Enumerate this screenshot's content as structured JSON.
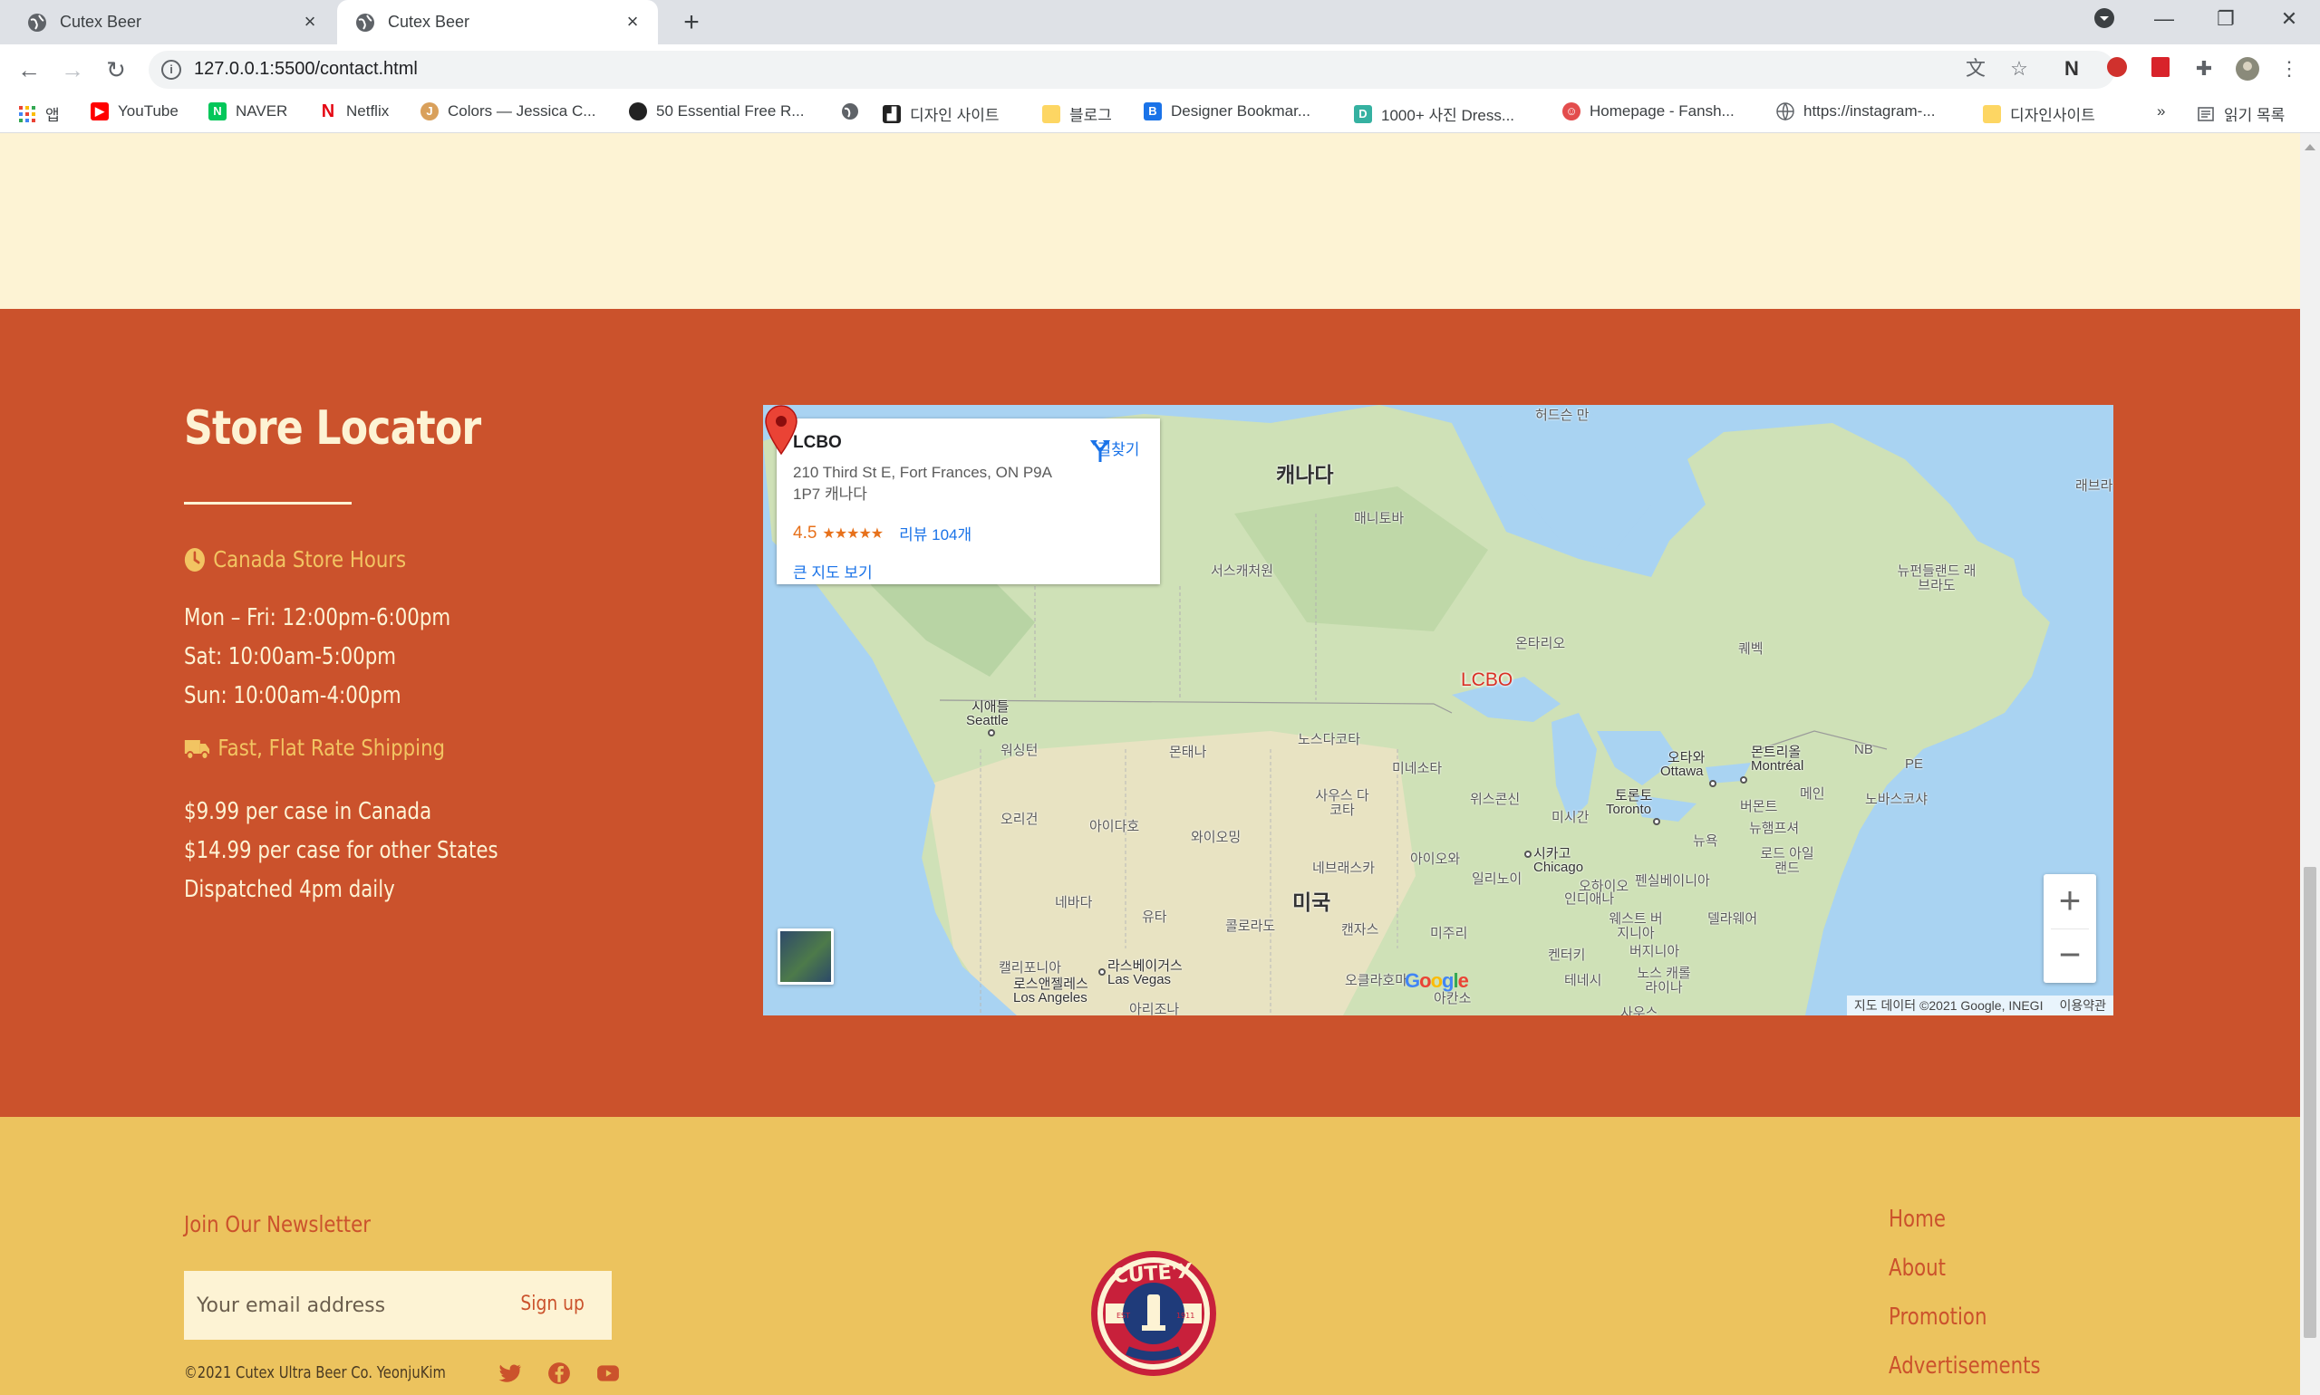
{
  "browser": {
    "tabs": [
      {
        "title": "Cutex Beer",
        "active": false
      },
      {
        "title": "Cutex Beer",
        "active": true
      }
    ],
    "url": "127.0.0.1:5500/contact.html",
    "bookmarks": [
      {
        "label": "앱",
        "icon": "apps-grid-icon"
      },
      {
        "label": "YouTube",
        "icon": "youtube-icon",
        "color": "#ff0000"
      },
      {
        "label": "NAVER",
        "icon": "naver-icon",
        "color": "#03c75a"
      },
      {
        "label": "Netflix",
        "icon": "netflix-icon",
        "color": "#e50914"
      },
      {
        "label": "Colors — Jessica C...",
        "icon": "colors-icon",
        "color": "#d9a05b"
      },
      {
        "label": "50 Essential Free R...",
        "icon": "dark-circle-icon",
        "color": "#222222"
      },
      {
        "label": "",
        "icon": "globe-icon"
      },
      {
        "label": "디자인 사이트",
        "icon": "folder-icon"
      },
      {
        "label": "블로그",
        "icon": "folder-icon"
      },
      {
        "label": "Designer Bookmar...",
        "icon": "designer-bookmark-icon",
        "color": "#1a73e8"
      },
      {
        "label": "1000+ 사진 Dress...",
        "icon": "dress-icon",
        "color": "#35b1a1"
      },
      {
        "label": "Homepage - Fansh...",
        "icon": "fansh-icon",
        "color": "#e34d4d"
      },
      {
        "label": "https://instagram-...",
        "icon": "globe-icon"
      },
      {
        "label": "디자인사이트",
        "icon": "folder-icon"
      }
    ],
    "reading_list": "읽기 목록",
    "more_bookmarks": "»"
  },
  "store_locator": {
    "title": "Store Locator",
    "hours_heading": "Canada Store Hours",
    "hours": [
      "Mon – Fri: 12:00pm-6:00pm",
      "Sat: 10:00am-5:00pm",
      "Sun: 10:00am-4:00pm"
    ],
    "shipping_heading": "Fast, Flat Rate Shipping",
    "shipping": [
      "$9.99 per case in Canada",
      "$14.99 per case for other States",
      "Dispatched 4pm daily"
    ]
  },
  "map": {
    "place_name": "LCBO",
    "address": "210 Third St E, Fort Frances, ON P9A 1P7 캐나다",
    "rating": "4.5",
    "stars": "★★★★★",
    "reviews": "리뷰 104개",
    "bigger_map": "큰 지도 보기",
    "directions": "길찾기",
    "pin_label": "LCBO",
    "zoom_in": "+",
    "zoom_out": "−",
    "attribution": "지도 데이터 ©2021 Google, INEGI",
    "terms": "이용약관",
    "google": "Google",
    "labels": {
      "canada": "캐나다",
      "usa": "미국",
      "hudson": "허드슨 만",
      "manitoba": "매니토바",
      "sask": "서스캐처원",
      "ontario": "온타리오",
      "quebec": "퀘벡",
      "newfoundland": "뉴펀들랜드 래브라도",
      "labrador": "래브라",
      "seattle_ko": "시애틀",
      "seattle": "Seattle",
      "washington": "워싱턴",
      "montana": "몬태나",
      "nd": "노스다코타",
      "minnesota": "미네소타",
      "sd": "사우스 다코타",
      "idaho": "아이다호",
      "wyoming": "와이오밍",
      "oregon": "오리건",
      "nebraska": "네브래스카",
      "iowa": "아이오와",
      "nevada": "네바다",
      "utah": "유타",
      "colorado": "콜로라도",
      "kansas": "캔자스",
      "missouri": "미주리",
      "wisconsin": "위스콘신",
      "michigan": "미시간",
      "illinois": "일리노이",
      "indiana": "인디애나",
      "ohio": "오하이오",
      "penn": "펜실베이니아",
      "ny": "뉴욕",
      "vermont": "버몬트",
      "nh": "뉴햄프셔",
      "maine": "메인",
      "ri": "로드 아일랜드",
      "nb": "NB",
      "pe": "PE",
      "ns": "노바스코샤",
      "ottawa_ko": "오타와",
      "ottawa": "Ottawa",
      "montreal_ko": "몬트리올",
      "montreal": "Montréal",
      "toronto_ko": "토론토",
      "toronto": "Toronto",
      "chicago_ko": "시카고",
      "chicago": "Chicago",
      "california": "캘리포니아",
      "la_ko": "로스앤젤레스",
      "la": "Los Angeles",
      "lv_ko": "라스베이거스",
      "lv": "Las Vegas",
      "arizona": "아리조나",
      "oklahoma": "오클라호마",
      "arkansas": "아칸소",
      "tennessee": "테네시",
      "kentucky": "켄터키",
      "wv": "웨스트 버지니아",
      "virginia": "버지니아",
      "delaware": "델라웨어",
      "nc": "노스 캐롤라이나",
      "sc": "사우스"
    }
  },
  "footer": {
    "newsletter_title": "Join Our Newsletter",
    "email_placeholder": "Your email address",
    "signup": "Sign up",
    "copyright": "©2021 Cutex Ultra Beer Co. YeonjuKim",
    "logo_text": "CUTE'X",
    "logo_est": "EST",
    "logo_year": "1911",
    "links": [
      "Home",
      "About",
      "Promotion",
      "Advertisements"
    ]
  },
  "colors": {
    "accent": "#cb522c",
    "cream": "#fdf3d4",
    "mustard": "#ecc35e",
    "gold_text": "#f2c462"
  }
}
